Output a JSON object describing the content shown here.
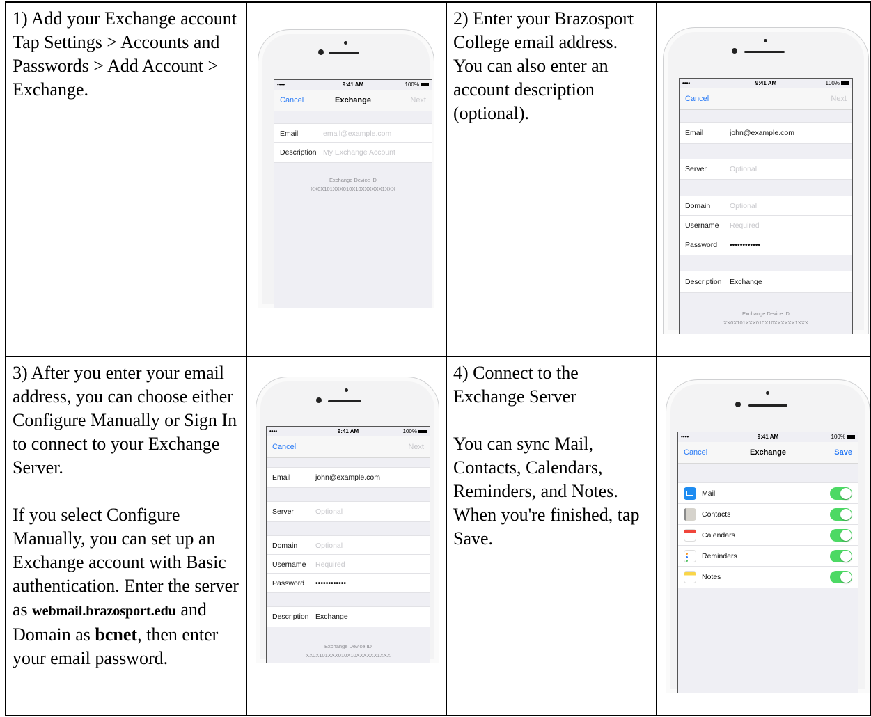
{
  "steps": [
    {
      "lines": [
        "1) Add your Exchange account",
        "Tap Settings > Accounts and Passwords > Add Account > Exchange."
      ]
    },
    {
      "lines": [
        "2) Enter your Brazosport College email address. You can also enter an account description (optional)."
      ]
    },
    {
      "para1": "3) After you enter your email address, you can choose either Configure Manually or Sign In to connect to your Exchange Server.",
      "para2_a": "If you select Configure Manually, you can set up an Exchange account with Basic authentication. Enter the server as ",
      "server_value": "webmail.brazosport.edu",
      "para2_b": " and Domain as ",
      "domain_value": "bcnet",
      "para2_c": ", then enter your email password."
    },
    {
      "heading": "4) Connect to the Exchange Server",
      "body": "You can sync Mail, Contacts, Calendars, Reminders, and Notes. When you're finished, tap Save."
    }
  ],
  "phone": {
    "time": "9:41 AM",
    "battery": "100%",
    "signal": "••••",
    "cancel": "Cancel",
    "title": "Exchange",
    "next": "Next",
    "save": "Save",
    "email_label": "Email",
    "email_placeholder": "email@example.com",
    "email_value": "john@example.com",
    "description_label": "Description",
    "description_placeholder": "My Exchange Account",
    "description_value": "Exchange",
    "server_label": "Server",
    "domain_label": "Domain",
    "username_label": "Username",
    "password_label": "Password",
    "optional": "Optional",
    "required": "Required",
    "password_dots": "••••••••••••",
    "device_id_label": "Exchange Device ID",
    "device_id": "XX0X101XXX010X10XXXXXX1XXX",
    "sync_items": [
      "Mail",
      "Contacts",
      "Calendars",
      "Reminders",
      "Notes"
    ]
  }
}
